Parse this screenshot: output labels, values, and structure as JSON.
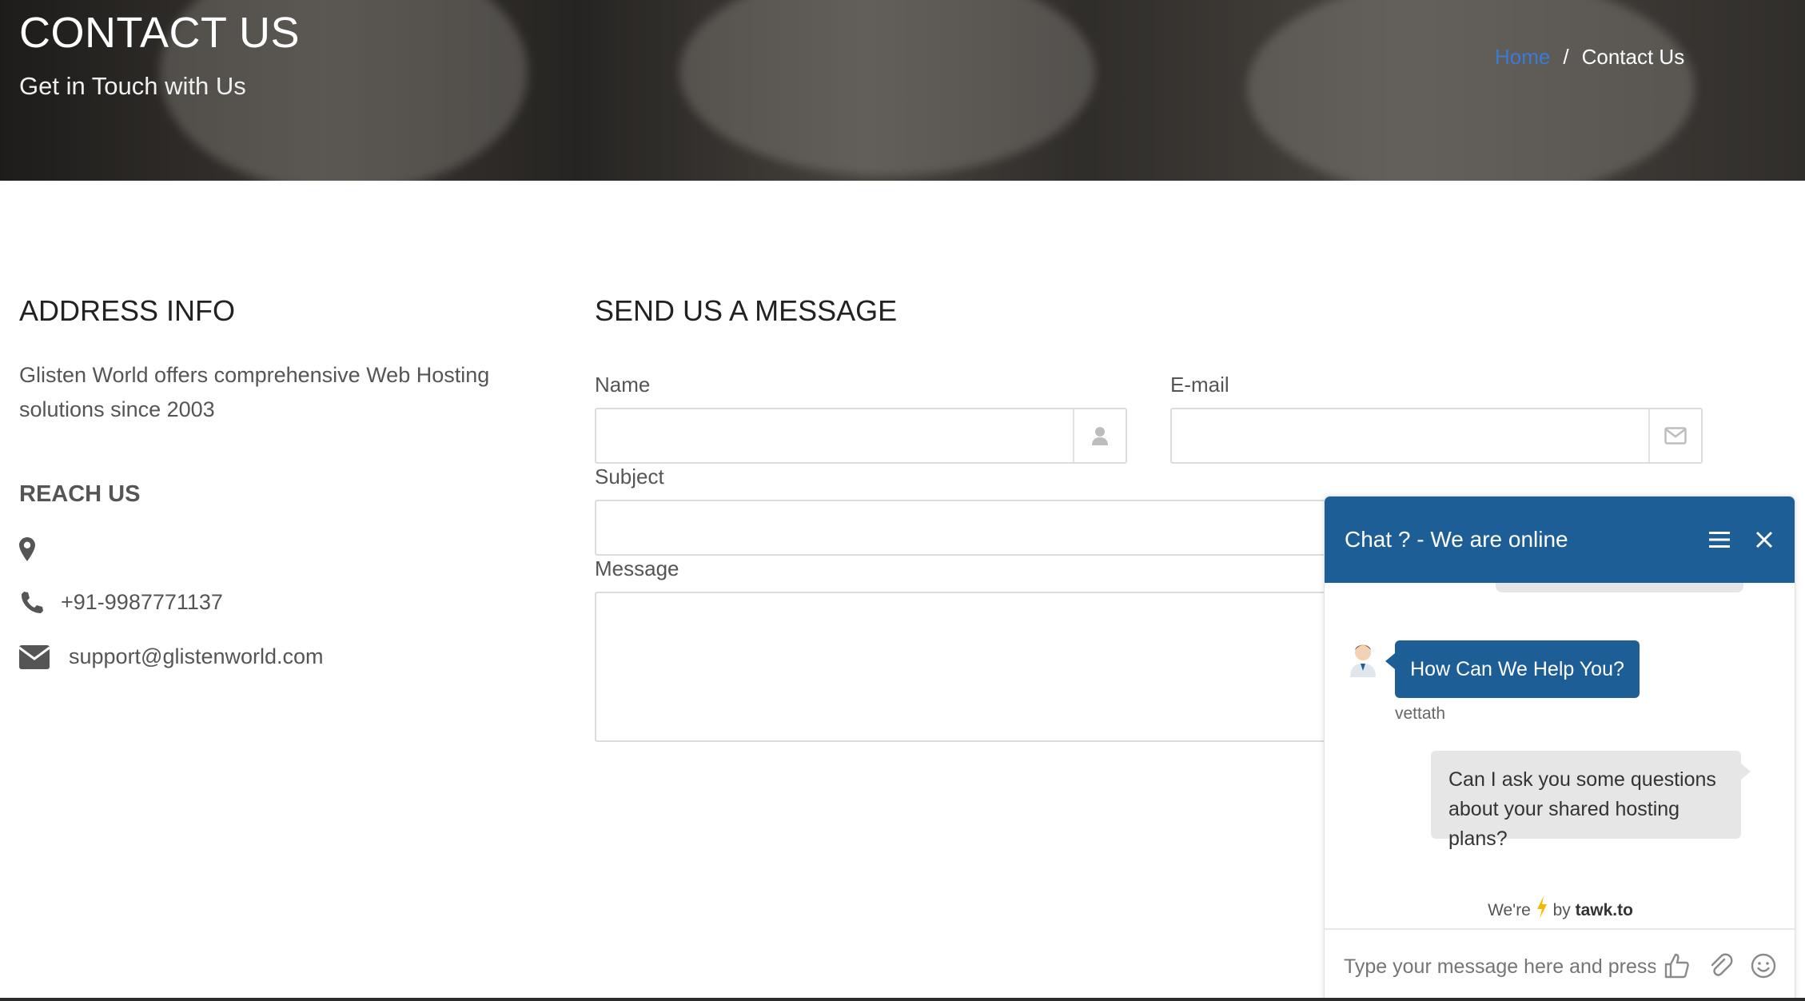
{
  "hero": {
    "title": "CONTACT US",
    "subtitle": "Get in Touch with Us",
    "breadcrumb": {
      "home": "Home",
      "separator": "/",
      "current": "Contact Us"
    }
  },
  "address": {
    "heading": "ADDRESS INFO",
    "text": "Glisten World offers comprehensive Web Hosting solutions since 2003",
    "reach_heading": "REACH US",
    "phone": "+91-9987771137",
    "email": "support@glistenworld.com"
  },
  "form": {
    "heading": "SEND US A MESSAGE",
    "name_label": "Name",
    "email_label": "E-mail",
    "subject_label": "Subject",
    "message_label": "Message",
    "name_value": "",
    "email_value": "",
    "subject_value": "",
    "message_value": ""
  },
  "chat": {
    "title": "Chat ? - We are online",
    "agent_message": "How Can We Help You?",
    "agent_name": "vettath",
    "user_message": "Can I ask you some questions about your shared hosting plans?",
    "powered_prefix": "We're",
    "powered_by": "by",
    "powered_brand": "tawk.to",
    "input_placeholder": "Type your message here and press",
    "header_color": "#1e5e96"
  },
  "colors": {
    "link": "#3a7bd5",
    "chat_header": "#1e5e96",
    "bolt": "#f5b800"
  }
}
